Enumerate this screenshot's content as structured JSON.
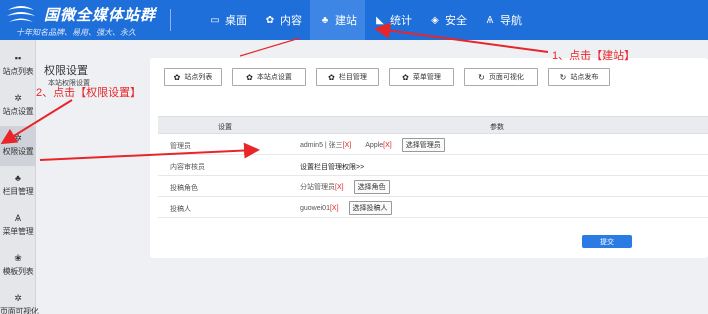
{
  "header": {
    "logo_title": "国微全媒体站群",
    "logo_sub": "十年知名品牌、易用、强大、永久",
    "nav": [
      {
        "icon": "desktop-icon",
        "glyph": "▭",
        "label": "桌面",
        "active": false
      },
      {
        "icon": "gear-icon",
        "glyph": "✿",
        "label": "内容",
        "active": false
      },
      {
        "icon": "tree-icon",
        "glyph": "♣",
        "label": "建站",
        "active": true
      },
      {
        "icon": "chart-icon",
        "glyph": "◣",
        "label": "统计",
        "active": false
      },
      {
        "icon": "shield-icon",
        "glyph": "◈",
        "label": "安全",
        "active": false
      },
      {
        "icon": "navigation-icon",
        "glyph": "Ѧ",
        "label": "导航",
        "active": false
      }
    ]
  },
  "sidebar": {
    "items": [
      {
        "icon": "grid-icon",
        "glyph": "▪▪",
        "label": "站点列表",
        "active": false
      },
      {
        "icon": "settings-icon",
        "glyph": "✲",
        "label": "站点设置",
        "active": false
      },
      {
        "icon": "settings-icon",
        "glyph": "✲",
        "label": "权限设置",
        "active": true
      },
      {
        "icon": "tree-icon",
        "glyph": "♣",
        "label": "栏目管理",
        "active": false
      },
      {
        "icon": "menu-icon",
        "glyph": "Ѧ",
        "label": "菜单管理",
        "active": false
      },
      {
        "icon": "template-icon",
        "glyph": "❀",
        "label": "模板列表",
        "active": false
      },
      {
        "icon": "visual-icon",
        "glyph": "✲",
        "label": "页面可视化",
        "active": false
      }
    ]
  },
  "section": {
    "title": "权限设置",
    "subtitle": "本站权限设置"
  },
  "tabs": [
    {
      "icon": "gear-icon",
      "glyph": "✿",
      "label": "站点列表"
    },
    {
      "icon": "gear-icon",
      "glyph": "✿",
      "label": "本站点设置"
    },
    {
      "icon": "gear-icon",
      "glyph": "✿",
      "label": "栏目管理"
    },
    {
      "icon": "gear-icon",
      "glyph": "✿",
      "label": "菜单管理"
    },
    {
      "icon": "refresh-icon",
      "glyph": "↻",
      "label": "页面可视化"
    },
    {
      "icon": "refresh-icon",
      "glyph": "↻",
      "label": "站点发布"
    }
  ],
  "table": {
    "headers": [
      "设置",
      "参数"
    ],
    "rows": {
      "admin": {
        "label": "管理员",
        "value1": "admin5 | 张三",
        "x": "[X]",
        "value2": "Apple",
        "button": "选择管理员"
      },
      "reviewer": {
        "label": "内容审核员",
        "value": "设置栏目管理权限>>"
      },
      "role": {
        "label": "投稿角色",
        "value": "分站管理员",
        "x": "[X]",
        "button": "选择角色"
      },
      "contributor": {
        "label": "投稿人",
        "value": "guowei01",
        "x": "[X]",
        "button": "选择投稿人"
      }
    },
    "submit": "提交"
  },
  "annotations": {
    "step1": "1、点击【建站】",
    "step2": "2、点击【权限设置】"
  },
  "colors": {
    "brand": "#1e6fd9",
    "annotation": "#e8262a",
    "submit": "#2a7be4"
  }
}
